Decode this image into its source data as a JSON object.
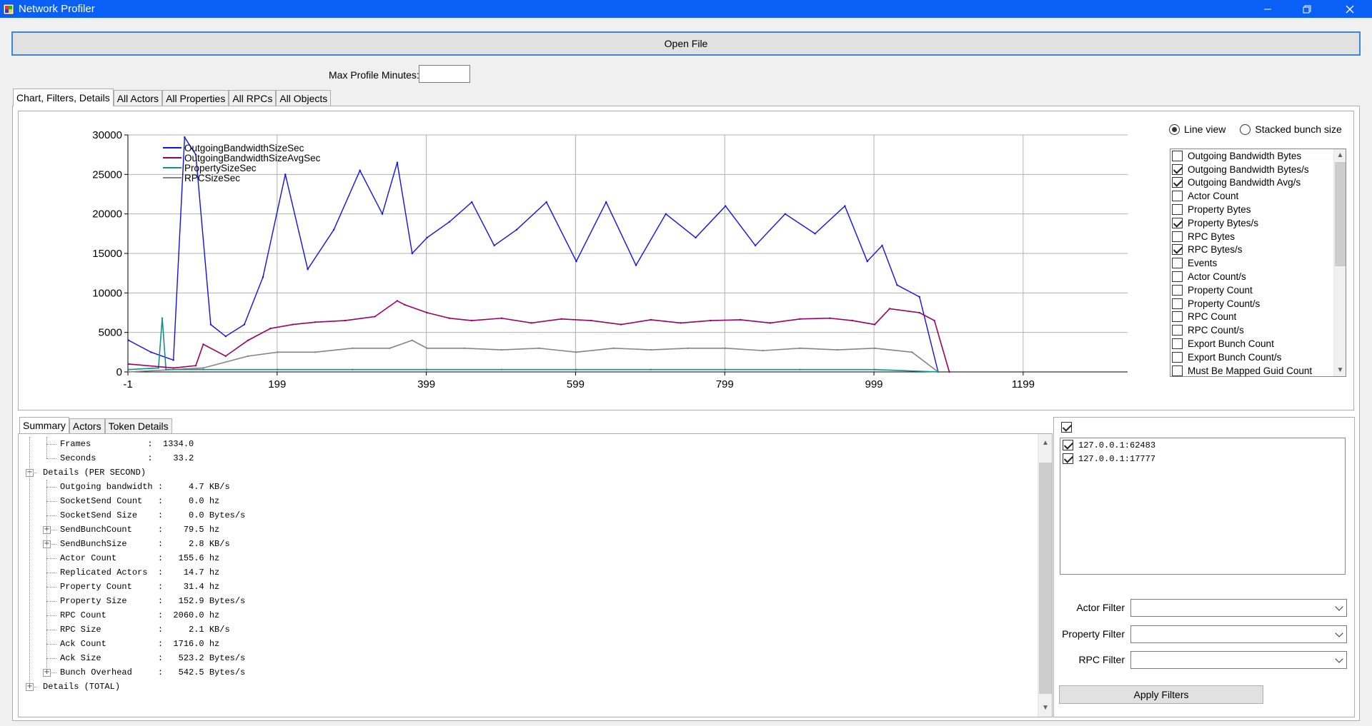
{
  "window": {
    "title": "Network Profiler"
  },
  "toolbar": {
    "open_file_label": "Open File",
    "max_profile_label": "Max Profile Minutes:",
    "max_profile_value": ""
  },
  "main_tabs": [
    {
      "label": "Chart, Filters, Details",
      "active": true
    },
    {
      "label": "All Actors",
      "active": false
    },
    {
      "label": "All Properties",
      "active": false
    },
    {
      "label": "All RPCs",
      "active": false
    },
    {
      "label": "All Objects",
      "active": false
    }
  ],
  "view_mode": {
    "line_view_label": "Line view",
    "stacked_label": "Stacked bunch size",
    "selected": "Line view"
  },
  "series_options": [
    {
      "label": "Outgoing Bandwidth Bytes",
      "checked": false
    },
    {
      "label": "Outgoing Bandwidth Bytes/s",
      "checked": true
    },
    {
      "label": "Outgoing Bandwidth Avg/s",
      "checked": true
    },
    {
      "label": "Actor Count",
      "checked": false
    },
    {
      "label": "Property Bytes",
      "checked": false
    },
    {
      "label": "Property Bytes/s",
      "checked": true
    },
    {
      "label": "RPC Bytes",
      "checked": false
    },
    {
      "label": "RPC Bytes/s",
      "checked": true
    },
    {
      "label": "Events",
      "checked": false
    },
    {
      "label": "Actor Count/s",
      "checked": false
    },
    {
      "label": "Property Count",
      "checked": false
    },
    {
      "label": "Property Count/s",
      "checked": false
    },
    {
      "label": "RPC Count",
      "checked": false
    },
    {
      "label": "RPC Count/s",
      "checked": false
    },
    {
      "label": "Export Bunch Count",
      "checked": false
    },
    {
      "label": "Export Bunch Count/s",
      "checked": false
    },
    {
      "label": "Must Be Mapped Guid Count",
      "checked": false
    }
  ],
  "chart_data": {
    "type": "line",
    "title": "",
    "xlabel": "",
    "ylabel": "",
    "x_ticks": [
      "-1",
      "199",
      "399",
      "599",
      "799",
      "999",
      "1199"
    ],
    "y_ticks": [
      "0",
      "5000",
      "10000",
      "15000",
      "20000",
      "25000",
      "30000"
    ],
    "xlim": [
      -1,
      1339
    ],
    "ylim": [
      0,
      30000
    ],
    "grid": true,
    "legend_position": "top-left",
    "series": [
      {
        "name": "OutgoingBandwidthSizeSec",
        "color": "#1010e8",
        "x": [
          0,
          30,
          60,
          75,
          90,
          110,
          130,
          155,
          180,
          210,
          240,
          275,
          310,
          340,
          360,
          380,
          400,
          430,
          460,
          490,
          520,
          560,
          600,
          640,
          680,
          720,
          760,
          800,
          840,
          880,
          920,
          960,
          990,
          1010,
          1030,
          1060,
          1085
        ],
        "values": [
          4000,
          2500,
          1500,
          29700,
          27500,
          6000,
          4500,
          6000,
          12000,
          25000,
          13000,
          18000,
          25500,
          20000,
          26500,
          15000,
          17000,
          19000,
          21500,
          16000,
          18000,
          21500,
          14000,
          21500,
          13500,
          20000,
          17000,
          21000,
          16000,
          20000,
          17500,
          21000,
          14000,
          16000,
          11000,
          9500,
          0
        ]
      },
      {
        "name": "OutgoingBandwidthSizeAvgSec",
        "color": "#990066",
        "x": [
          0,
          60,
          90,
          100,
          130,
          160,
          190,
          220,
          250,
          290,
          330,
          360,
          370,
          400,
          430,
          460,
          500,
          540,
          580,
          620,
          660,
          700,
          740,
          780,
          820,
          860,
          900,
          940,
          970,
          1000,
          1020,
          1060,
          1080,
          1100
        ],
        "values": [
          1000,
          500,
          800,
          3500,
          2000,
          4000,
          5500,
          6000,
          6300,
          6500,
          7000,
          9000,
          8500,
          7500,
          6800,
          6500,
          6800,
          6200,
          6700,
          6500,
          6000,
          6600,
          6200,
          6500,
          6600,
          6200,
          6700,
          6800,
          6500,
          6000,
          8000,
          7500,
          6500,
          0
        ]
      },
      {
        "name": "PropertySizeSec",
        "color": "#12908c",
        "x": [
          0,
          40,
          45,
          50,
          100,
          200,
          300,
          400,
          500,
          600,
          700,
          800,
          900,
          1000,
          1085
        ],
        "values": [
          300,
          500,
          6800,
          300,
          300,
          300,
          300,
          300,
          300,
          300,
          300,
          300,
          300,
          300,
          0
        ]
      },
      {
        "name": "RPCSizeSec",
        "color": "#858585",
        "x": [
          0,
          100,
          160,
          200,
          250,
          300,
          350,
          380,
          400,
          450,
          500,
          550,
          600,
          650,
          700,
          750,
          800,
          850,
          900,
          950,
          1000,
          1050,
          1085
        ],
        "values": [
          0,
          500,
          2000,
          2500,
          2500,
          3000,
          3000,
          4000,
          3000,
          3000,
          2800,
          3000,
          2500,
          3000,
          2800,
          3000,
          3000,
          2700,
          3000,
          2800,
          3000,
          2500,
          0
        ]
      }
    ]
  },
  "bottom_tabs": [
    {
      "label": "Summary",
      "active": true
    },
    {
      "label": "Actors",
      "active": false
    },
    {
      "label": "Token Details",
      "active": false
    }
  ],
  "summary_rows": [
    {
      "level": 1,
      "expander": "",
      "text": "Frames           :  1334.0"
    },
    {
      "level": 1,
      "expander": "",
      "text": "Seconds          :    33.2"
    },
    {
      "level": 0,
      "expander": "-",
      "text": "Details (PER SECOND)"
    },
    {
      "level": 1,
      "expander": "",
      "text": "Outgoing bandwidth :     4.7 KB/s"
    },
    {
      "level": 1,
      "expander": "",
      "text": "SocketSend Count   :     0.0 hz"
    },
    {
      "level": 1,
      "expander": "",
      "text": "SocketSend Size    :     0.0 Bytes/s"
    },
    {
      "level": 1,
      "expander": "+",
      "text": "SendBunchCount     :    79.5 hz"
    },
    {
      "level": 1,
      "expander": "+",
      "text": "SendBunchSize      :     2.8 KB/s"
    },
    {
      "level": 1,
      "expander": "",
      "text": "Actor Count        :   155.6 hz"
    },
    {
      "level": 1,
      "expander": "",
      "text": "Replicated Actors  :    14.7 hz"
    },
    {
      "level": 1,
      "expander": "",
      "text": "Property Count     :    31.4 hz"
    },
    {
      "level": 1,
      "expander": "",
      "text": "Property Size      :   152.9 Bytes/s"
    },
    {
      "level": 1,
      "expander": "",
      "text": "RPC Count          :  2060.0 hz"
    },
    {
      "level": 1,
      "expander": "",
      "text": "RPC Size           :     2.1 KB/s"
    },
    {
      "level": 1,
      "expander": "",
      "text": "Ack Count          :  1716.0 hz"
    },
    {
      "level": 1,
      "expander": "",
      "text": "Ack Size           :   523.2 Bytes/s"
    },
    {
      "level": 1,
      "expander": "+",
      "text": "Bunch Overhead     :   542.5 Bytes/s"
    },
    {
      "level": 0,
      "expander": "+",
      "text": "Details (TOTAL)"
    }
  ],
  "connections": {
    "select_all_checked": true,
    "items": [
      {
        "label": "127.0.0.1:62483",
        "checked": true
      },
      {
        "label": "127.0.0.1:17777",
        "checked": true
      }
    ]
  },
  "filters": {
    "actor_label": "Actor Filter",
    "property_label": "Property Filter",
    "rpc_label": "RPC Filter",
    "apply_label": "Apply Filters"
  }
}
